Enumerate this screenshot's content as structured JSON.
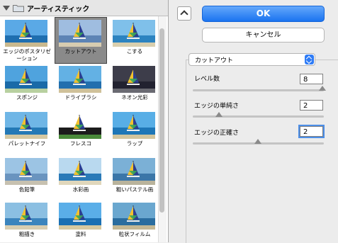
{
  "gallery": {
    "category": "アーティスティック",
    "filters": [
      {
        "label": "エッジのポスタリゼーション",
        "selected": false
      },
      {
        "label": "カットアウト",
        "selected": true
      },
      {
        "label": "こする",
        "selected": false
      },
      {
        "label": "スポンジ",
        "selected": false
      },
      {
        "label": "ドライブラシ",
        "selected": false
      },
      {
        "label": "ネオン光彩",
        "selected": false
      },
      {
        "label": "パレットナイフ",
        "selected": false
      },
      {
        "label": "フレスコ",
        "selected": false
      },
      {
        "label": "ラップ",
        "selected": false
      },
      {
        "label": "色鉛筆",
        "selected": false
      },
      {
        "label": "水彩画",
        "selected": false
      },
      {
        "label": "粗いパステル画",
        "selected": false
      },
      {
        "label": "粗描き",
        "selected": false
      },
      {
        "label": "塗料",
        "selected": false
      },
      {
        "label": "粒状フィルム",
        "selected": false
      }
    ]
  },
  "buttons": {
    "ok": "OK",
    "cancel": "キャンセル"
  },
  "filter_select": {
    "value": "カットアウト"
  },
  "params": {
    "levels": {
      "label": "レベル数",
      "value": "8",
      "slider_fraction": 1.0
    },
    "simplicity": {
      "label": "エッジの単純さ",
      "value": "2",
      "slider_fraction": 0.2
    },
    "fidelity": {
      "label": "エッジの正確さ",
      "value": "2",
      "slider_fraction": 0.5
    }
  }
}
